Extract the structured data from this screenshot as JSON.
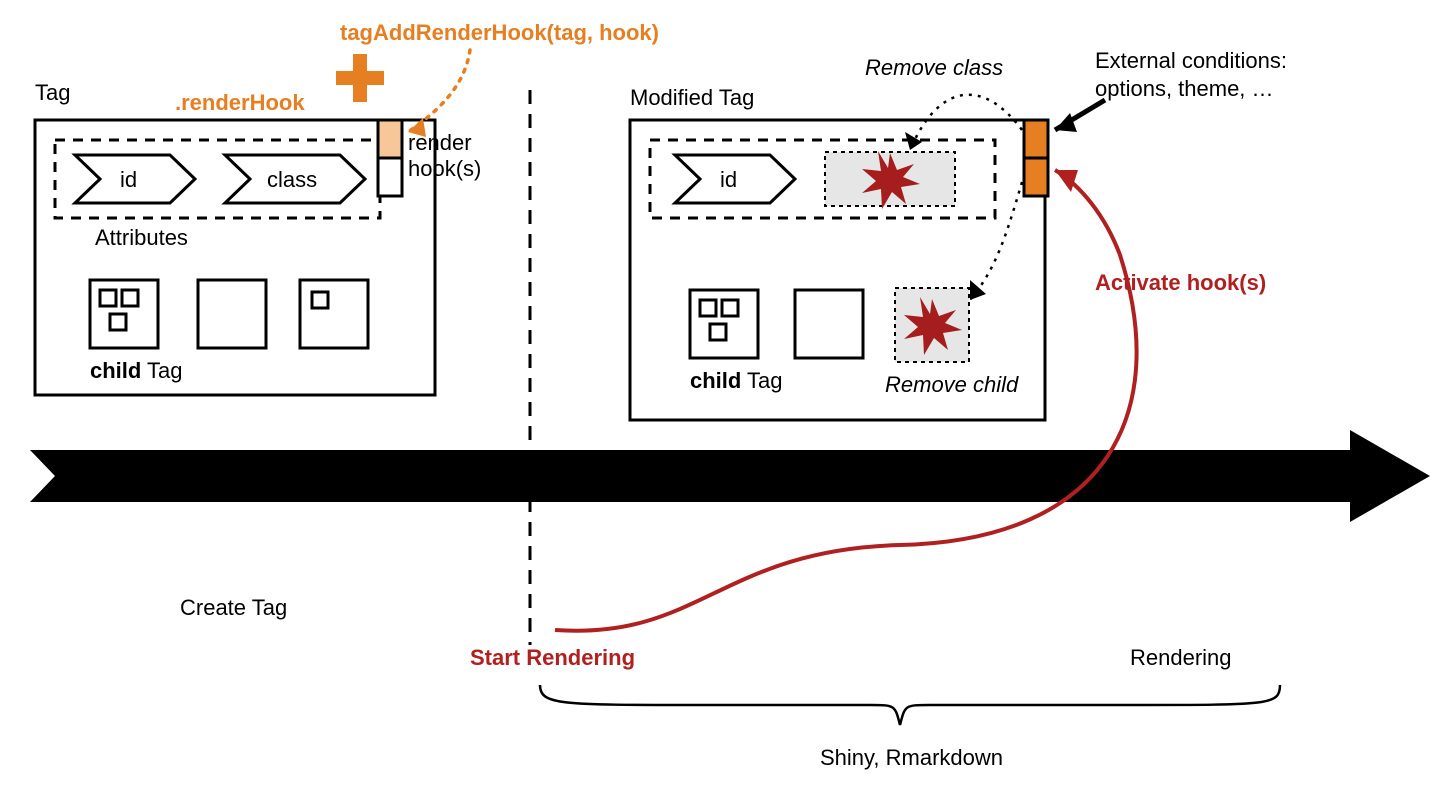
{
  "colors": {
    "orange": "#e67e22",
    "orange_light": "#f7c699",
    "red": "#b02020",
    "burst": "#a51d1d",
    "black": "#000000",
    "grey_fill": "#e6e6e6"
  },
  "labels": {
    "fn": "tagAddRenderHook(tag, hook)",
    "render_hook_attr": ".renderHook",
    "tag_title": "Tag",
    "modified_tag_title": "Modified Tag",
    "render_hooks_1": "render",
    "render_hooks_2": "hook(s)",
    "attr_id": "id",
    "attr_class": "class",
    "attributes": "Attributes",
    "child_tag": "child Tag",
    "child_bold": "child",
    "tag_word": " Tag",
    "remove_class": "Remove class",
    "remove_child": "Remove child",
    "ext_cond_1": "External conditions:",
    "ext_cond_2": "options, theme, …",
    "create_tag": "Create Tag",
    "start_rendering": "Start Rendering",
    "activate_hooks": "Activate hook(s)",
    "rendering": "Rendering",
    "footer": "Shiny, Rmarkdown"
  }
}
